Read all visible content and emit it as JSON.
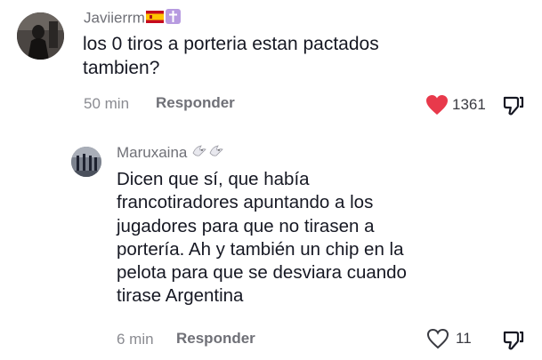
{
  "comments": [
    {
      "username": "Javiierrm",
      "username_badges": [
        "spain-flag-icon",
        "cross-icon"
      ],
      "text_line1": "los 0 tiros a porteria estan pactados",
      "text_line2": "tambien?",
      "time": "50 min",
      "reply_label": "Responder",
      "like_count": "1361",
      "liked": true
    },
    {
      "username": "Maruxaina",
      "username_badges": [
        "dove-icon",
        "dove-icon"
      ],
      "text_lines": [
        "Dicen que sí, que había",
        "francotiradores apuntando a los",
        "jugadores para que no tirasen a",
        "portería. Ah y también un chip en la",
        "pelota para que se desviara cuando",
        "tirase Argentina"
      ],
      "time": "6 min",
      "reply_label": "Responder",
      "like_count": "11",
      "liked": false
    }
  ],
  "colors": {
    "text": "#161823",
    "muted": "#8a8b91",
    "like_red": "#e8394b"
  }
}
